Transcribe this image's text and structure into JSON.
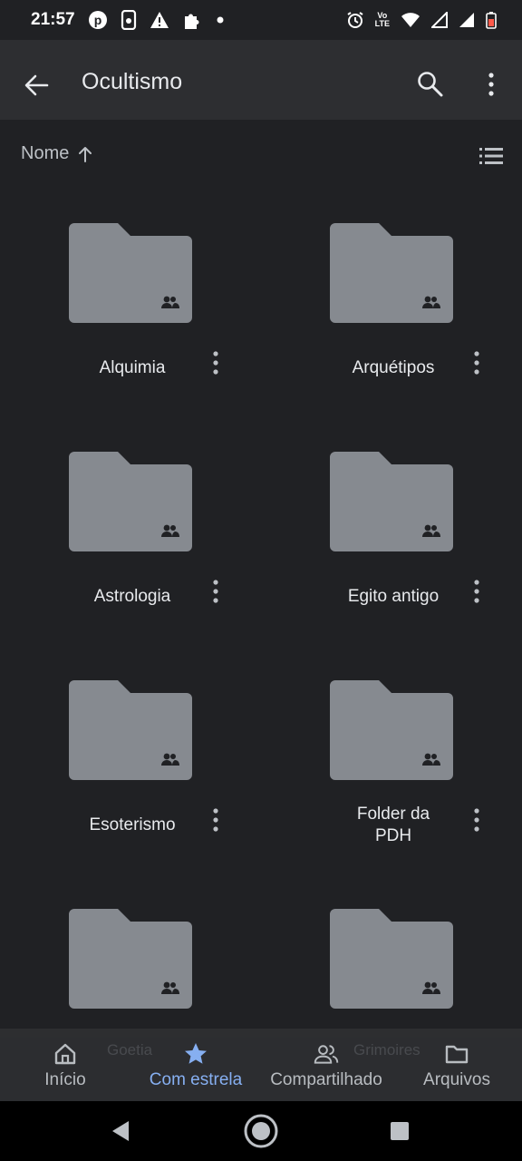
{
  "status_bar": {
    "time": "21:57",
    "network_badge": "LTE",
    "network_badge_top": "Vo"
  },
  "app_bar": {
    "title": "Ocultismo"
  },
  "sort": {
    "label": "Nome"
  },
  "folders": [
    {
      "name": "Alquimia"
    },
    {
      "name": "Arquétipos"
    },
    {
      "name": "Astrologia"
    },
    {
      "name": "Egito antigo"
    },
    {
      "name": "Esoterismo"
    },
    {
      "name": "Folder da PDH"
    },
    {
      "name": "Goetia"
    },
    {
      "name": "Grimoires"
    }
  ],
  "bottom_nav": {
    "items": [
      {
        "label": "Início",
        "icon": "home-icon"
      },
      {
        "label": "Com estrela",
        "icon": "star-icon",
        "active": true
      },
      {
        "label": "Compartilhado",
        "icon": "shared-people-icon"
      },
      {
        "label": "Arquivos",
        "icon": "folder-icon"
      }
    ]
  },
  "colors": {
    "background": "#202124",
    "app_bar": "#2d2e31",
    "folder": "#868a90",
    "accent": "#8ab4f8"
  }
}
